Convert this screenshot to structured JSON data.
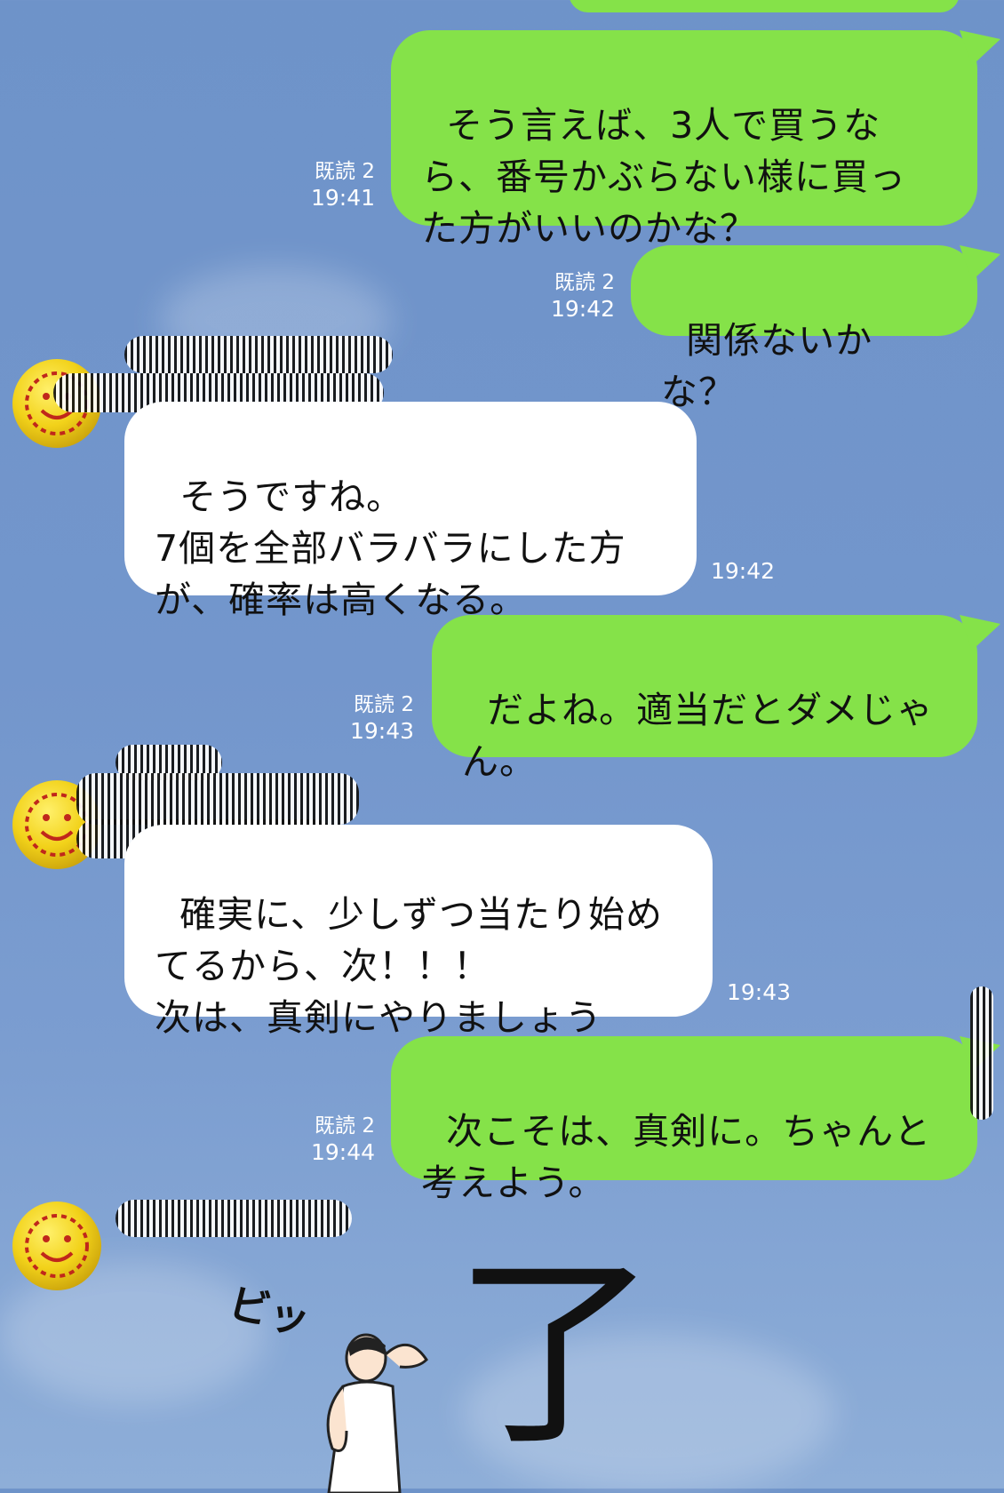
{
  "chat": {
    "messages": [
      {
        "side": "out",
        "text": "そう言えば、3人で買うな\nら、番号かぶらない様に買っ\nた方がいいのかな？",
        "read": "既読 2",
        "time": "19:41"
      },
      {
        "side": "out",
        "text": "関係ないかな？",
        "read": "既読 2",
        "time": "19:42"
      },
      {
        "side": "in",
        "text": "そうですね。\n7個を全部バラバラにした方\nが、確率は高くなる。",
        "time": "19:42"
      },
      {
        "side": "out",
        "text": "だよね。適当だとダメじゃ\nん。",
        "read": "既読 2",
        "time": "19:43"
      },
      {
        "side": "in",
        "text": "確実に、少しずつ当たり始め\nてるから、次！！！\n次は、真剣にやりましょう",
        "time": "19:43"
      },
      {
        "side": "out",
        "text": "次こそは、真剣に。ちゃんと\n考えよう。",
        "read": "既読 2",
        "time": "19:44"
      }
    ],
    "sticker": {
      "sfx": "ビッ",
      "kanji": "了"
    }
  },
  "colors": {
    "outgoing_bubble": "#85e249",
    "incoming_bubble": "#ffffff",
    "background": "#7396cc",
    "meta_text": "#ffffff"
  },
  "icons": {
    "avatar": "smiley-avatar-icon",
    "redaction": "redacted-name"
  }
}
